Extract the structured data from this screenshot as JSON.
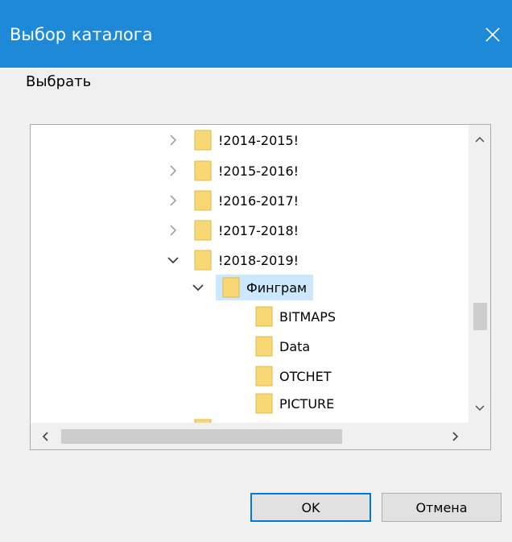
{
  "dialog": {
    "title": "Выбор каталога",
    "prompt": "Выбрать",
    "ok_label": "OK",
    "cancel_label": "Отмена"
  },
  "tree": {
    "items": [
      {
        "label": "!2014-2015!",
        "state": "collapsed",
        "level": 0
      },
      {
        "label": "!2015-2016!",
        "state": "collapsed",
        "level": 0
      },
      {
        "label": "!2016-2017!",
        "state": "collapsed",
        "level": 0
      },
      {
        "label": "!2017-2018!",
        "state": "collapsed",
        "level": 0
      },
      {
        "label": "!2018-2019!",
        "state": "expanded",
        "level": 0
      },
      {
        "label": "Финграм",
        "state": "expanded",
        "level": 1,
        "selected": true
      },
      {
        "label": "BITMAPS",
        "state": "leaf",
        "level": 2
      },
      {
        "label": "Data",
        "state": "leaf",
        "level": 2
      },
      {
        "label": "OTCHET",
        "state": "leaf",
        "level": 2
      },
      {
        "label": "PICTURE",
        "state": "leaf",
        "level": 2
      }
    ]
  },
  "colors": {
    "titlebar": "#1e89d6",
    "selection": "#cce8ff",
    "folder": "#f8d775",
    "default_button_border": "#0078d7"
  }
}
